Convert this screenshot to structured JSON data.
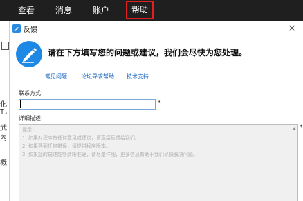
{
  "menubar": {
    "items": [
      "查看",
      "消息",
      "账户",
      "帮助"
    ],
    "active_item": "帮助"
  },
  "background_text": {
    "lines": [
      "化",
      "T.",
      "武",
      "內",
      "概"
    ]
  },
  "dialog": {
    "title": "反馈",
    "close_glyph": "×",
    "headline": "请在下方填写您的问题或建议，我们会尽快为您处理。",
    "links": [
      "常见问题",
      "论坛寻求帮助",
      "技术支持"
    ],
    "contact": {
      "label": "联系方式:",
      "value": "",
      "required_mark": "*"
    },
    "detail": {
      "label": "详细描述:",
      "required_mark": "*",
      "placeholder_lines": [
        "提示：",
        "1. 如果对程序有任何意见或建议，请直接反馈给我们。",
        "2. 如果遇到任何错误，请提供程序版本。",
        "3. 如果您的描述能够清晰准确，请尽量详细，更多信息有助于我们尽快解决问题。"
      ]
    }
  },
  "colors": {
    "menubar_bg": "#1f1f1f",
    "active_border": "#e02020",
    "accent": "#1e88e5",
    "link": "#1565c0"
  }
}
